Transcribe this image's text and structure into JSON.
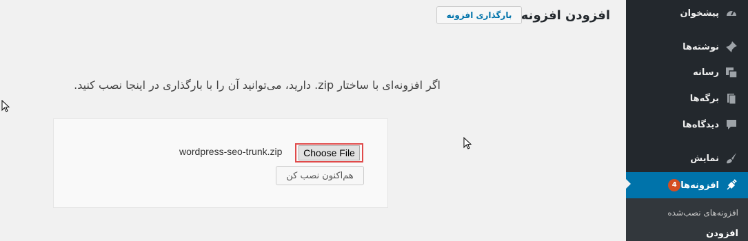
{
  "header": {
    "title": "افزودن افزونه",
    "upload_button": "بارگذاری افزونه"
  },
  "help_text": "اگر افزونه‌ای با ساختار zip. دارید، می‌توانید آن را با بارگذاری در اینجا نصب کنید.",
  "upload": {
    "file_name": "wordpress-seo-trunk.zip",
    "choose_file_label": "Choose File",
    "install_button": "هم‌اکنون نصب کن"
  },
  "sidebar": {
    "items": [
      {
        "label": "پیشخوان",
        "icon": "dashboard-icon"
      },
      {
        "label": "نوشته‌ها",
        "icon": "pin-icon"
      },
      {
        "label": "رسانه",
        "icon": "media-icon"
      },
      {
        "label": "برگه‌ها",
        "icon": "pages-icon"
      },
      {
        "label": "دیدگاه‌ها",
        "icon": "comments-icon"
      },
      {
        "label": "نمایش",
        "icon": "appearance-icon"
      },
      {
        "label": "افزونه‌ها",
        "icon": "plugins-icon",
        "badge": "4"
      }
    ],
    "submenu": [
      {
        "label": "افزونه‌های نصب‌شده"
      },
      {
        "label": "افزودن"
      }
    ]
  },
  "colors": {
    "sidebar_bg": "#23282d",
    "active_bg": "#0073aa",
    "badge_bg": "#d54e21",
    "highlight_border": "#e04a4a"
  }
}
